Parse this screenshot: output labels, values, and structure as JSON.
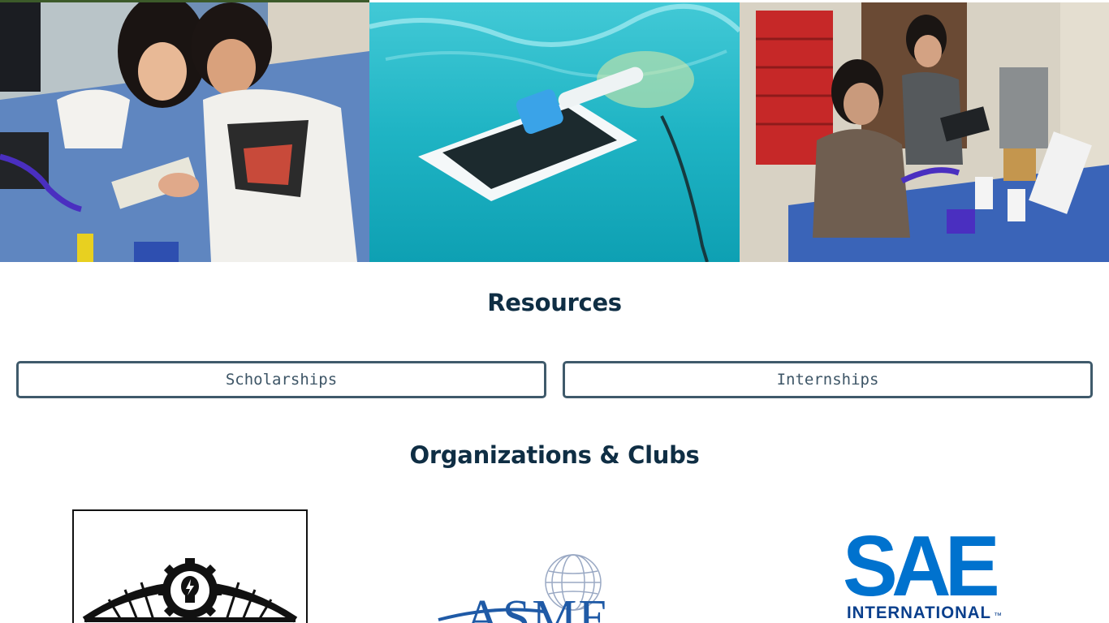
{
  "resources": {
    "title": "Resources",
    "buttons": [
      {
        "label": "Scholarships"
      },
      {
        "label": "Internships"
      }
    ]
  },
  "organizations": {
    "title": "Organizations & Clubs",
    "logos": [
      {
        "name": "bridge-gear-lightbulb-logo",
        "text": ""
      },
      {
        "name": "asme-logo",
        "text": "ASME"
      },
      {
        "name": "sae-international-logo",
        "text": "SAE",
        "subtext": "INTERNATIONAL",
        "tm": "™"
      }
    ]
  },
  "photos": [
    {
      "name": "students-soldering-photo"
    },
    {
      "name": "underwater-robot-photo"
    },
    {
      "name": "lab-workbench-photo"
    }
  ],
  "colors": {
    "heading": "#0f2e44",
    "button_border": "#3f5a6b",
    "button_text": "#3d5566",
    "sae_blue": "#0072ce",
    "asme_blue": "#1f5aa6"
  }
}
